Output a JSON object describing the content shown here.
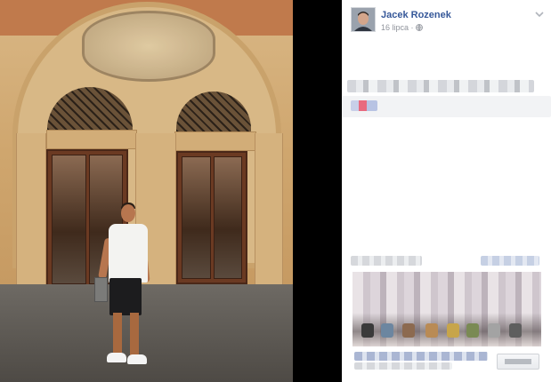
{
  "post": {
    "author_name": "Jacek Rozenek",
    "date": "16 lipca",
    "separator": "·",
    "privacy_icon": "globe-icon",
    "menu_icon": "chevron-down-icon"
  },
  "photo": {
    "subject": "man-in-front-of-arched-doorway"
  },
  "colors": {
    "author_link": "#365899",
    "meta_text": "#90949c",
    "panel_bg": "#ffffff",
    "viewer_bg": "#000000"
  }
}
